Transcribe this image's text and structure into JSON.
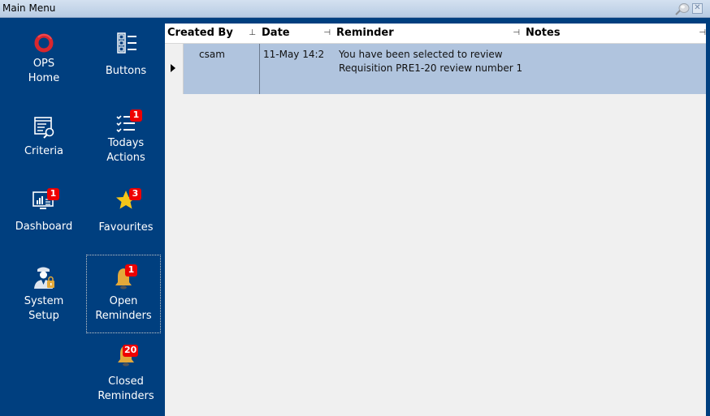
{
  "window": {
    "title": "Main Menu",
    "pin_icon": "pushpin-icon",
    "close_label": "✕"
  },
  "sidebar": {
    "tiles": [
      {
        "id": "ops-home",
        "label_line1": "OPS",
        "label_line2": "Home",
        "icon": "ops-logo-icon",
        "badge": null
      },
      {
        "id": "buttons",
        "label_line1": "Buttons",
        "label_line2": "",
        "icon": "button-list-icon",
        "badge": null
      },
      {
        "id": "criteria",
        "label_line1": "Criteria",
        "label_line2": "",
        "icon": "criteria-search-icon",
        "badge": null
      },
      {
        "id": "todays-actions",
        "label_line1": "Todays",
        "label_line2": "Actions",
        "icon": "checklist-icon",
        "badge": "1"
      },
      {
        "id": "dashboard",
        "label_line1": "Dashboard",
        "label_line2": "",
        "icon": "dashboard-chart-icon",
        "badge": "1"
      },
      {
        "id": "favourites",
        "label_line1": "Favourites",
        "label_line2": "",
        "icon": "star-icon",
        "badge": "3"
      },
      {
        "id": "system-setup",
        "label_line1": "System",
        "label_line2": "Setup",
        "icon": "admin-officer-icon",
        "badge": null
      },
      {
        "id": "open-reminders",
        "label_line1": "Open",
        "label_line2": "Reminders",
        "icon": "bell-icon",
        "badge": "1"
      },
      {
        "id": "closed-reminders",
        "label_line1": "Closed",
        "label_line2": "Reminders",
        "icon": "bell-icon",
        "badge": "20"
      }
    ]
  },
  "grid": {
    "columns": [
      {
        "label": "Created By",
        "pin": "⊥"
      },
      {
        "label": "Date",
        "pin": "⊣"
      },
      {
        "label": "Reminder",
        "pin": "⊣"
      },
      {
        "label": "Notes",
        "pin": "⊣"
      }
    ],
    "rows": [
      {
        "created_by": "csam",
        "date": "11-May 14:2",
        "reminder": "You have been selected to review Requisition PRE1-20 review number 1",
        "notes": ""
      }
    ]
  },
  "colors": {
    "sidebar_bg": "#003f7f",
    "selected_row": "#b0c4de",
    "badge": "#ee0000",
    "bell": "#e3a93a",
    "star": "#f5c518",
    "ops_red": "#d9272e"
  }
}
